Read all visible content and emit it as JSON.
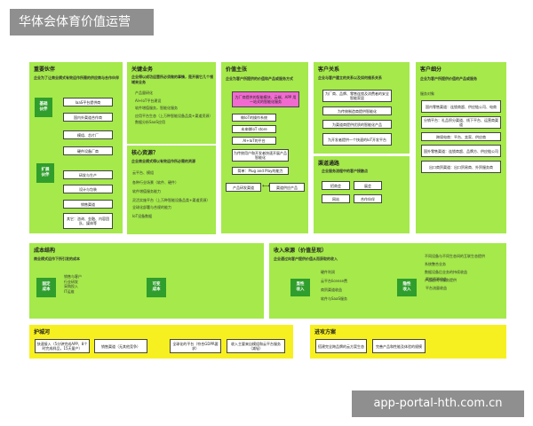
{
  "header": {
    "title": "华体会体育价值运营"
  },
  "watermark": "app-portal-hth.com.cn",
  "key_partners": {
    "title": "重要伙伴",
    "subtitle": "企业为了让商业模式有效运作所需的供应商与合作伙伴",
    "basic_label": "基础\n伙伴",
    "basic_items": [
      "IaaS平台提供商",
      "国内外渠道合作商",
      "模组、芯片厂",
      "硬件设备厂商"
    ],
    "expand_label": "扩展\n伙伴",
    "expand_items": [
      "研发与生产",
      "设计与包装",
      "销售渠道",
      "其它：咨询、金融、内容团队、媒体等"
    ]
  },
  "key_activities": {
    "title": "关键业务",
    "subtitle": "企业得以成功运营所必须做的事情，是开展它几个领域来业务",
    "items": [
      "产品量研化",
      "AI+IoT平台建设",
      "软件增值服务，智能化服务",
      "应用平台生态（上万种智能设备品类+渠道资源）",
      "数据分析SaaS应用"
    ]
  },
  "key_resources": {
    "title": "核心资源？",
    "subtitle": "企业商业模式得以有效运作所必需的资源",
    "items": [
      "云平台、模组",
      "各种行业场景（软件、硬件）",
      "软件增值服务能力",
      "灵活实施平台（上万种智能设备品类+渠道资源）",
      "全球化部署与合规的能力",
      "IoT设备数据"
    ]
  },
  "value_proposition": {
    "title": "价值主张",
    "subtitle": "企业为客户所提供的价值和产品或服务方式",
    "highlight": "为厂商提供的智能模块、云端、APP 用一站式的智能化服务",
    "items": [
      "做IoT的操作系统",
      "未来做IoT store",
      "AI+IoT的平台",
      "为传统用户和开发者快速开展产品智能化",
      "简单：Plug and Play的能力"
    ],
    "bottom_left": "产品研发渠道",
    "bottom_right": "渠道供应产品"
  },
  "customer_relationships": {
    "title": "客户关系",
    "subtitle": "企业与客户建立的关系以及如何维系关系",
    "items": [
      "为厂商、品牌、零售连锁及消费者的安全智能家居",
      "为传统制造商提供智能化",
      "为渠道商提供优质的智能化产品",
      "为开发者提供一个快速的IoT开发平台"
    ]
  },
  "channels": {
    "title": "渠道通路",
    "subtitle": "企业服务流程中的客户接触点",
    "items": [
      "招商会",
      "展会",
      "网站",
      "合作伙伴"
    ]
  },
  "customer_segments": {
    "title": "客户细分",
    "subtitle": "企业为客户所提供价值的产品或服务",
    "group": "服务对象",
    "items": [
      "国内零售渠道：连锁商超、供应链公司、电商",
      "分销平台：礼品积分渠道、线下平台、运营商渠道",
      "跨境电商：平台、卖家、供应商",
      "国外零售渠道：连锁商超、品牌方、供应链公司",
      "出口商贸渠道：出口贸易商、外贸服务商"
    ]
  },
  "cost_structure": {
    "title": "成本结构",
    "subtitle": "商业模式运作下所引发的成本",
    "fixed_label": "固定\n成本",
    "fixed_text": "销售与客户\n行业研发\n采购投入\nIT运维",
    "variable_label": "可变\n成本"
  },
  "revenue_streams": {
    "title": "收入来源（价值呈现）",
    "subtitle": "企业通过向客户提供价值从而获取的收入",
    "explicit_label": "显性\n收入",
    "explicit_items": [
      "硬件利润",
      "云平台license费",
      "商贸渠道收益",
      "软件与SaaS服务"
    ],
    "implicit_label": "隐性\n收入",
    "implicit_items": [
      "渠道资源收益",
      "平台流量收益"
    ],
    "right_items": [
      "不同设备与不同生态间的互联生态提供",
      "系统整合业务",
      "数据设备后业务的持续收益",
      "产品迭代与服务提供"
    ]
  },
  "moat": {
    "title": "护城河",
    "items": [
      "快速接入（5分钟完成APP、8个时完成样品，15天量产）",
      "销售渠道（无其他竞争）",
      "全球化的平台（符合GDPR要求）",
      "收入主要来自模组和云平台服务（减轻）"
    ]
  },
  "advance_plan": {
    "title": "进攻方案",
    "items": [
      "搭建完全跨品牌的云方案生态",
      "完善产品和性能及体验的规模"
    ]
  }
}
